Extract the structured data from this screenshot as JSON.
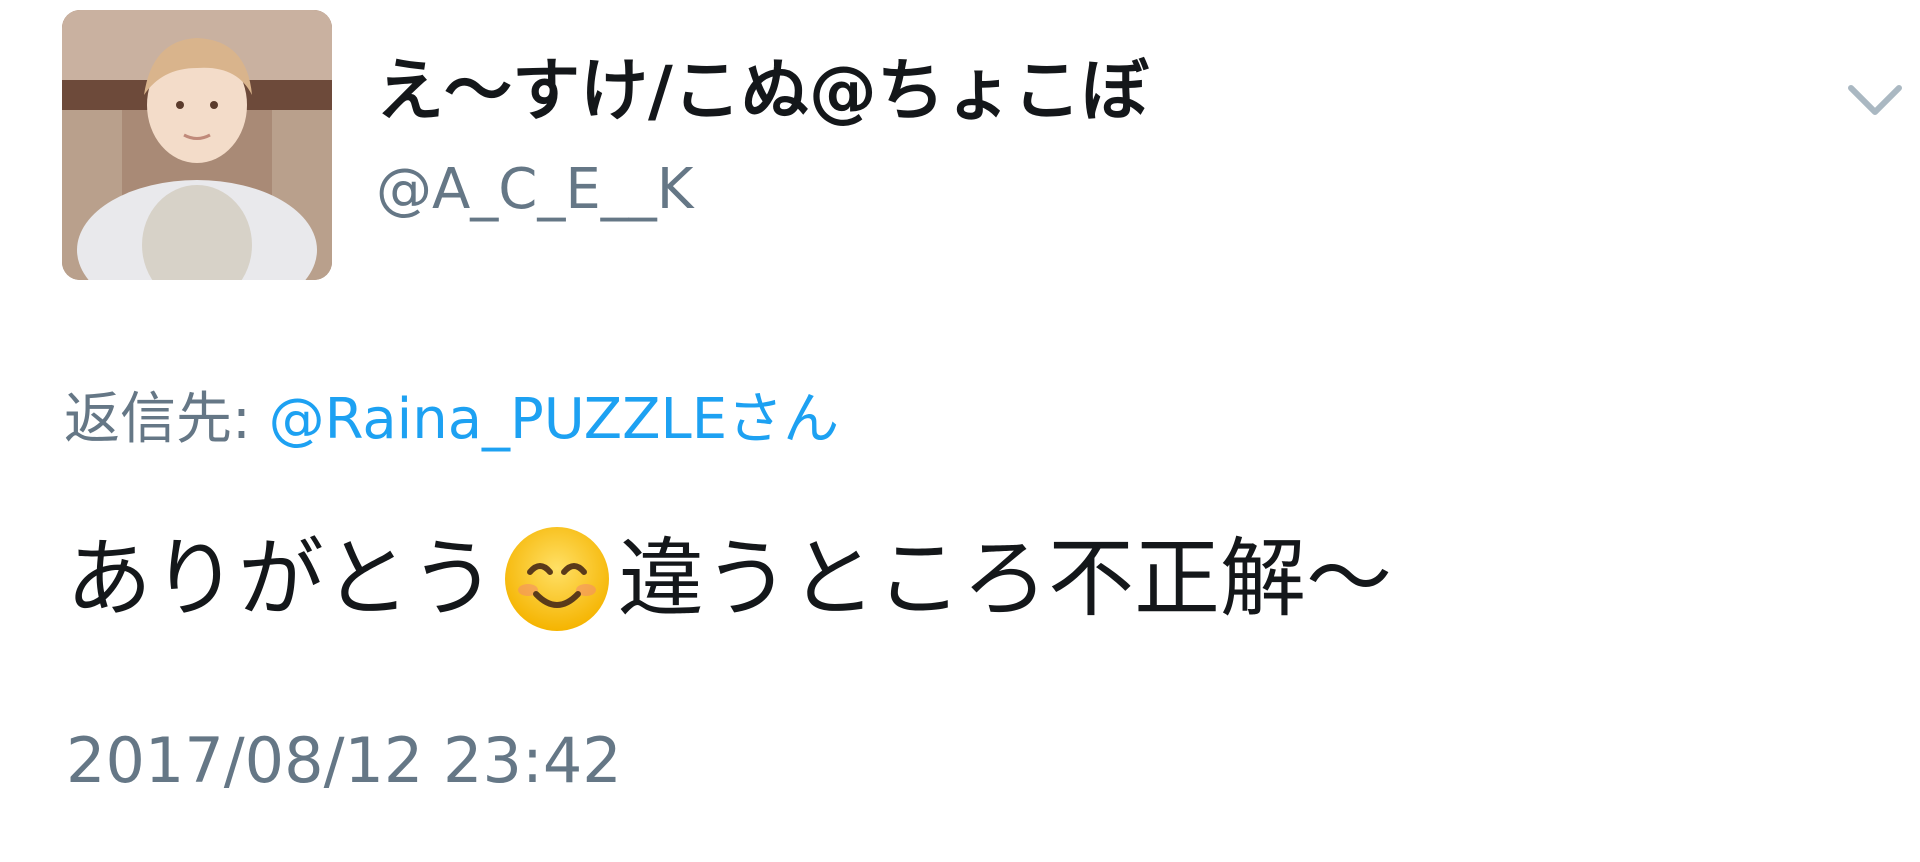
{
  "tweet": {
    "display_name": "え〜すけ/こぬ@ちょこぼ",
    "handle": "@A_C_E__K",
    "reply_prefix": "返信先: ",
    "reply_target": "@Raina_PUZZLEさん",
    "text_before_emoji": "ありがとう",
    "emoji": "smiling-face-with-smiling-eyes",
    "text_after_emoji": "違うところ不正解〜",
    "timestamp": "2017/08/12 23:42"
  },
  "icons": {
    "menu": "chevron-down-icon"
  },
  "colors": {
    "name": "#14171a",
    "secondary": "#657786",
    "link": "#1da1f2"
  }
}
